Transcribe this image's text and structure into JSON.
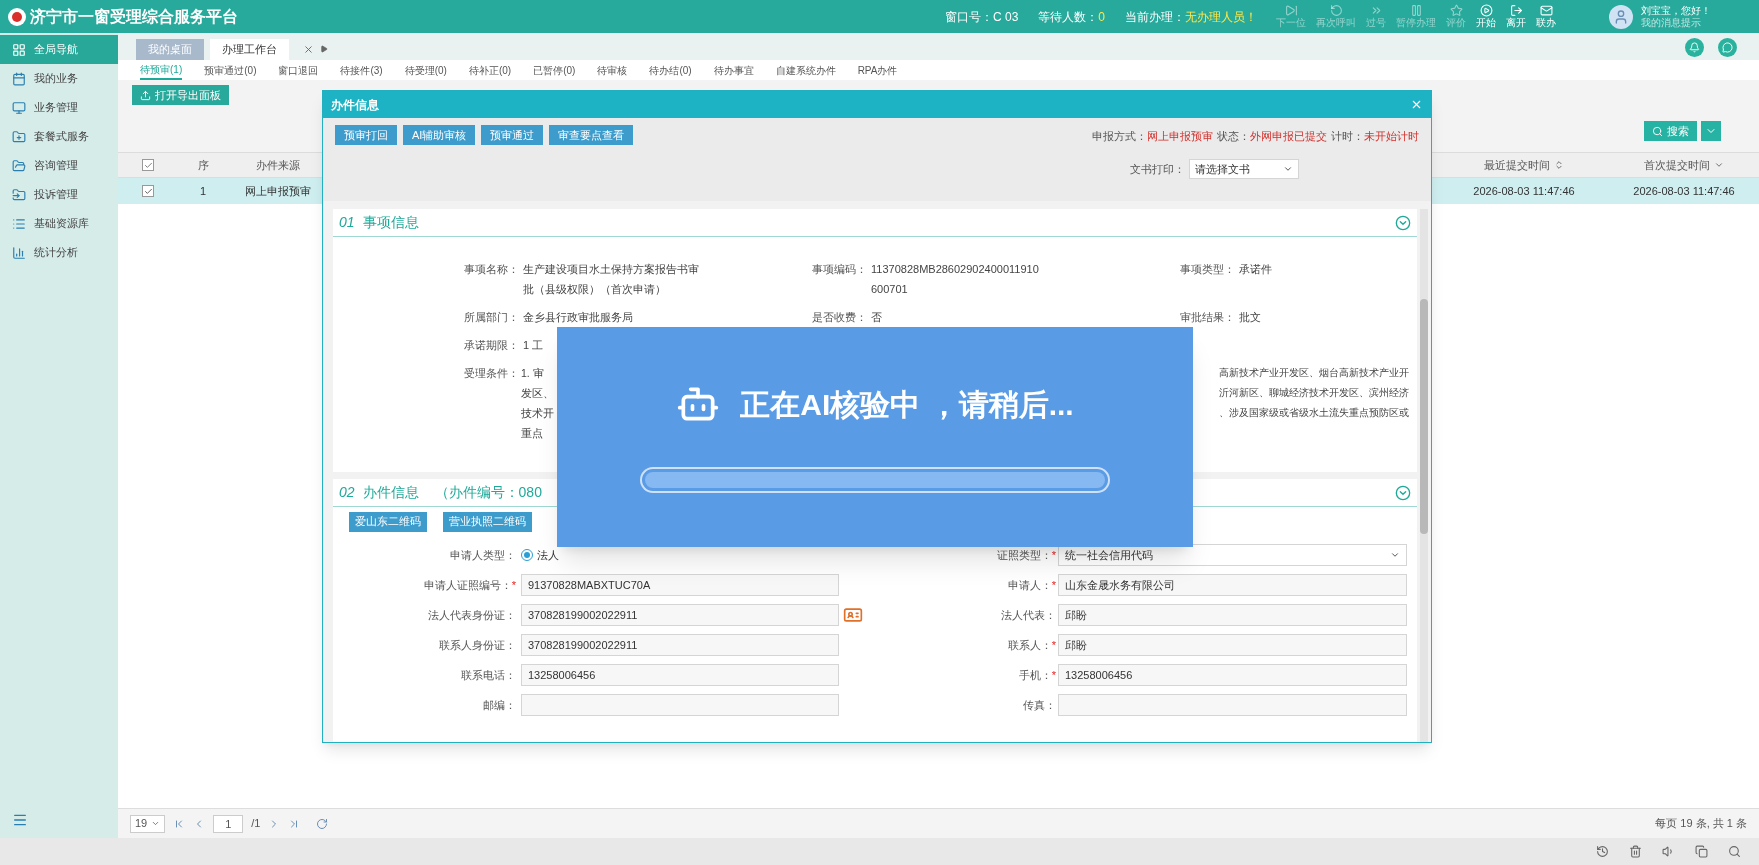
{
  "header": {
    "title": "济宁市一窗受理综合服务平台",
    "window_no": "窗口号：C 03",
    "waiting_label": "等待人数：",
    "waiting_count": "0",
    "current_label": "当前办理：",
    "current_value": "无办理人员！",
    "tools": [
      {
        "label": "下一位",
        "disabled": true
      },
      {
        "label": "再次呼叫",
        "disabled": true
      },
      {
        "label": "过号",
        "disabled": true
      },
      {
        "label": "暂停办理",
        "disabled": true
      },
      {
        "label": "评价",
        "disabled": true
      },
      {
        "label": "开始",
        "disabled": false
      },
      {
        "label": "离开",
        "disabled": false
      },
      {
        "label": "联办",
        "disabled": false
      }
    ],
    "user_greeting": "刘宝宝，您好！",
    "user_link": "我的消息提示"
  },
  "sidebar": {
    "items": [
      {
        "label": "全局导航",
        "selected": true
      },
      {
        "label": "我的业务",
        "selected": false
      },
      {
        "label": "业务管理",
        "selected": false
      },
      {
        "label": "套餐式服务",
        "selected": false
      },
      {
        "label": "咨询管理",
        "selected": false
      },
      {
        "label": "投诉管理",
        "selected": false
      },
      {
        "label": "基础资源库",
        "selected": false
      },
      {
        "label": "统计分析",
        "selected": false
      }
    ]
  },
  "tabs": [
    {
      "label": "我的桌面",
      "selected": false
    },
    {
      "label": "办理工作台",
      "selected": true
    }
  ],
  "subtabs": [
    {
      "label": "待预审(1)",
      "selected": true
    },
    {
      "label": "预审通过(0)",
      "selected": false
    },
    {
      "label": "窗口退回",
      "selected": false
    },
    {
      "label": "待接件(3)",
      "selected": false
    },
    {
      "label": "待受理(0)",
      "selected": false
    },
    {
      "label": "待补正(0)",
      "selected": false
    },
    {
      "label": "已暂停(0)",
      "selected": false
    },
    {
      "label": "待审核",
      "selected": false
    },
    {
      "label": "待办结(0)",
      "selected": false
    },
    {
      "label": "待办事宜",
      "selected": false
    },
    {
      "label": "自建系统办件",
      "selected": false
    },
    {
      "label": "RPA办件",
      "selected": false
    }
  ],
  "export_button": "打开导出面板",
  "search_button": "搜索",
  "table": {
    "all_checked": true,
    "columns": [
      "序",
      "办件来源",
      "最近提交时间",
      "首次提交时间"
    ],
    "rows": [
      {
        "cells": [
          "1",
          "网上申报预审",
          "2026-08-03 11:47:46",
          "2026-08-03 11:47:46"
        ],
        "selected": true,
        "checked": true
      }
    ]
  },
  "pager": {
    "page_size": "19",
    "page": "1",
    "total_pages": "/1",
    "summary": "每页 19 条, 共 1 条"
  },
  "dialog": {
    "title": "办件信息",
    "buttons": [
      "预审打回",
      "AI辅助审核",
      "预审通过",
      "审查要点查看"
    ],
    "status": [
      {
        "label": "申报方式：",
        "value": "网上申报预审"
      },
      {
        "label": "状态：",
        "value": "外网申报已提交"
      },
      {
        "label": "计时：",
        "value": "未开始计时"
      }
    ],
    "print_label": "文书打印：",
    "print_select": "请选择文书",
    "section1": {
      "number": "01",
      "title": "事项信息",
      "rows": [
        {
          "cells": [
            {
              "label": "事项名称：",
              "value": "生产建设项目水土保持方案报告书审批（县级权限）（首次申请）"
            },
            {
              "label": "事项编码：",
              "value": "11370828MB28602902400011910600701"
            },
            {
              "label": "事项类型：",
              "value": "承诺件"
            }
          ]
        },
        {
          "cells": [
            {
              "label": "所属部门：",
              "value": "金乡县行政审批服务局"
            },
            {
              "label": "是否收费：",
              "value": "否"
            },
            {
              "label": "审批结果：",
              "value": "批文"
            }
          ]
        },
        {
          "cells": [
            {
              "label": "承诺期限：",
              "value": "1 工"
            }
          ]
        }
      ],
      "condition": {
        "label": "受理条件：",
        "lines": [
          {
            "left": "1. 审",
            "right": "高新技术产业开发区、烟台高新技术产业开"
          },
          {
            "left": "发区、",
            "right": "沂河新区、聊城经济技术开发区、滨州经济"
          },
          {
            "left": "技术开",
            "right": "、涉及国家级或省级水土流失重点预防区或"
          },
          {
            "left": "重点"
          }
        ]
      }
    },
    "section2": {
      "number": "02",
      "title": "办件信息",
      "subtitle": "（办件编号：080",
      "buttons": [
        "爱山东二维码",
        "营业执照二维码"
      ],
      "rows": [
        [
          {
            "label": "申请人类型：",
            "kind": "radio",
            "value": "法人",
            "selected": true,
            "card_reader": false
          },
          {
            "label": "证照类型：",
            "mark": "*",
            "kind": "select",
            "value": "统一社会信用代码"
          }
        ],
        [
          {
            "label": "申请人证照编号：",
            "mark": "*",
            "kind": "input",
            "value": "91370828MABXTUC70A",
            "card_reader": false
          },
          {
            "label": "申请人：",
            "mark": "*",
            "kind": "input",
            "value": "山东金晟水务有限公司"
          }
        ],
        [
          {
            "label": "法人代表身份证：",
            "kind": "input",
            "value": "370828199002022911",
            "card_reader": true
          },
          {
            "label": "法人代表：",
            "kind": "input",
            "value": "邱盼"
          }
        ],
        [
          {
            "label": "联系人身份证：",
            "kind": "input",
            "value": "370828199002022911",
            "card_reader": false
          },
          {
            "label": "联系人：",
            "mark": "*",
            "kind": "input",
            "value": "邱盼"
          }
        ],
        [
          {
            "label": "联系电话：",
            "kind": "input",
            "value": "13258006456",
            "card_reader": false
          },
          {
            "label": "手机：",
            "mark": "*",
            "kind": "input",
            "value": "13258006456"
          }
        ],
        [
          {
            "label": "邮编：",
            "kind": "input",
            "card_reader": false
          },
          {
            "label": "传真：",
            "kind": "input"
          }
        ]
      ]
    },
    "loading": {
      "message": "正在AI核验中 ，请稍后...",
      "level": 1
    }
  }
}
